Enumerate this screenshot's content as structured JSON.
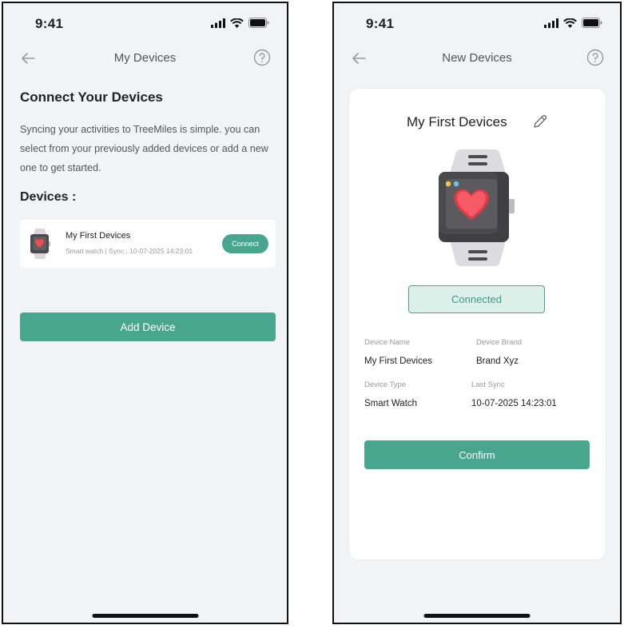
{
  "colors": {
    "accent": "#48a58e",
    "background": "#f2f3f7",
    "connected_bg": "#dcefe9"
  },
  "left_screen": {
    "status_time": "9:41",
    "nav": {
      "back_icon": "arrow-left-icon",
      "title": "My Devices",
      "help_icon": "help-circle-icon"
    },
    "heading": "Connect Your Devices",
    "description": "Syncing your activities to TreeMiles is simple.  you can select from your previously added devices or add a new one to get started.",
    "devices_label": "Devices :",
    "device": {
      "icon": "smartwatch-icon",
      "name": "My First Devices",
      "meta": "Smart watch | Sync : 10-07-2025 14:23:01",
      "connect_label": "Connect"
    },
    "add_device_label": "Add Device"
  },
  "right_screen": {
    "status_time": "9:41",
    "nav": {
      "back_icon": "arrow-left-icon",
      "title": "New Devices",
      "help_icon": "help-circle-icon"
    },
    "device_title": "My First Devices",
    "edit_icon": "pencil-icon",
    "status": "Connected",
    "info": {
      "device_name_label": "Device Name",
      "device_name": "My First Devices",
      "device_brand_label": "Device Brand",
      "device_brand": "Brand Xyz",
      "device_type_label": "Device Type",
      "device_type": "Smart Watch",
      "last_sync_label": "Last Sync",
      "last_sync": "10-07-2025 14:23:01"
    },
    "confirm_label": "Confirm"
  }
}
